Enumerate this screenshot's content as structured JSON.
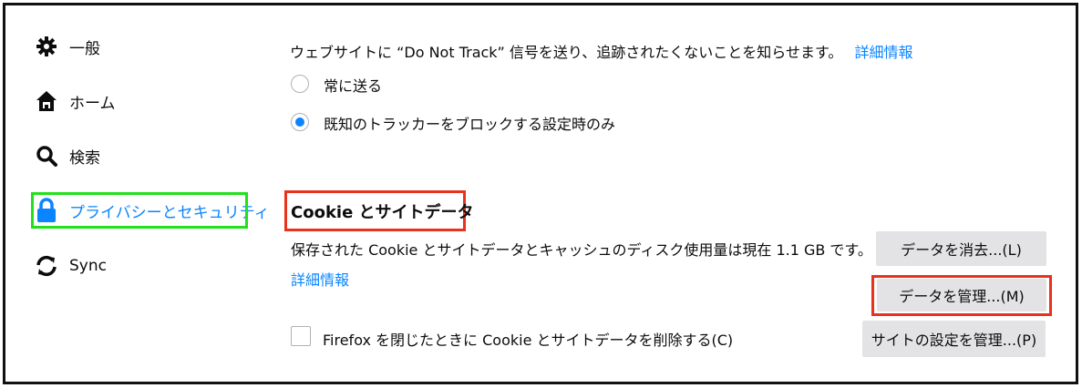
{
  "sidebar": {
    "items": [
      {
        "label": "一般",
        "icon": "gear-icon"
      },
      {
        "label": "ホーム",
        "icon": "home-icon"
      },
      {
        "label": "検索",
        "icon": "search-icon"
      },
      {
        "label": "プライバシーとセキュリティ",
        "icon": "lock-icon",
        "selected": true
      },
      {
        "label": "Sync",
        "icon": "sync-icon"
      }
    ]
  },
  "dnt": {
    "description": "ウェブサイトに “Do Not Track” 信号を送り、追跡されたくないことを知らせます。",
    "learn_more": "詳細情報",
    "options": [
      {
        "label": "常に送る",
        "checked": false
      },
      {
        "label": "既知のトラッカーをブロックする設定時のみ",
        "checked": true
      }
    ]
  },
  "cookies": {
    "heading": "Cookie とサイトデータ",
    "usage_text": "保存された Cookie とサイトデータとキャッシュのディスク使用量は現在 1.1 GB です。",
    "learn_more": "詳細情報",
    "clear_button": "データを消去...(L)",
    "manage_button": "データを管理...(M)",
    "site_settings_button": "サイトの設定を管理...(P)",
    "delete_on_close": {
      "label": "Firefox を閉じたときに Cookie とサイトデータを削除する(C)",
      "checked": false
    }
  },
  "colors": {
    "accent": "#0a84ff",
    "highlight_green": "#22e01a",
    "highlight_red": "#e8321b"
  }
}
